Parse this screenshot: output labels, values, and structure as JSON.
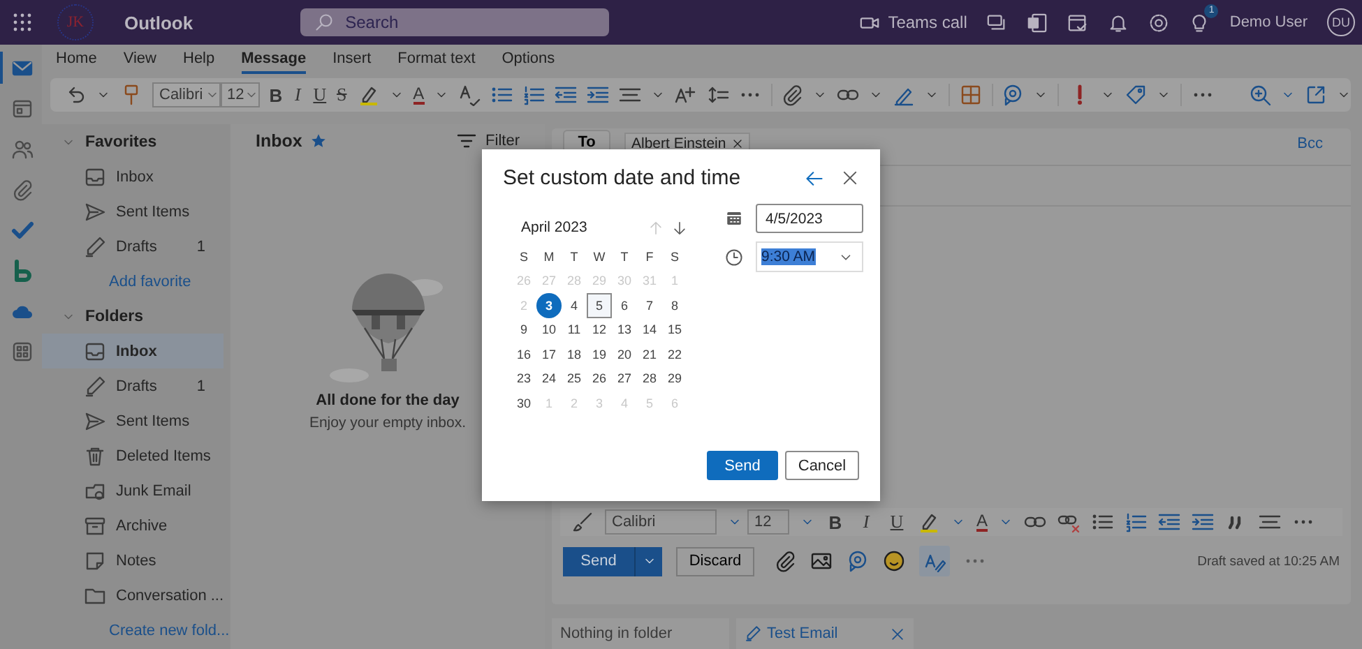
{
  "topbar": {
    "logo_text": "JK",
    "app_name": "Outlook",
    "search": {
      "placeholder": "Search"
    },
    "teams_call": "Teams call",
    "tips_badge": "1",
    "user_name": "Demo User",
    "avatar_initials": "DU"
  },
  "rail": [
    {
      "kind": "mail",
      "selected": true
    },
    {
      "kind": "calendar",
      "selected": false
    },
    {
      "kind": "people",
      "selected": false
    },
    {
      "kind": "files",
      "selected": false
    },
    {
      "kind": "todo",
      "selected": false
    },
    {
      "kind": "bookings",
      "selected": false
    },
    {
      "kind": "onedrive",
      "selected": false
    },
    {
      "kind": "apps",
      "selected": false
    }
  ],
  "ribbon": {
    "tabs": [
      {
        "label": "Home",
        "selected": false
      },
      {
        "label": "View",
        "selected": false
      },
      {
        "label": "Help",
        "selected": false
      },
      {
        "label": "Message",
        "selected": true
      },
      {
        "label": "Insert",
        "selected": false
      },
      {
        "label": "Format text",
        "selected": false
      },
      {
        "label": "Options",
        "selected": false
      }
    ],
    "font": "Calibri",
    "size": "12",
    "style_buttons": [
      {
        "kind": "bold",
        "label": "B"
      },
      {
        "kind": "italic",
        "label": "I"
      },
      {
        "kind": "underline",
        "label": "U"
      },
      {
        "kind": "strike",
        "label": "S"
      }
    ],
    "font_color": "A"
  },
  "folders": {
    "sections": [
      {
        "label": "Favorites",
        "items": [
          {
            "kind": "inbox",
            "label": "Inbox",
            "selected": false
          },
          {
            "kind": "sent",
            "label": "Sent Items",
            "selected": false
          },
          {
            "kind": "drafts",
            "label": "Drafts",
            "count": "1",
            "selected": false
          }
        ],
        "link": "Add favorite"
      },
      {
        "label": "Folders",
        "items": [
          {
            "kind": "inbox",
            "label": "Inbox",
            "selected": true
          },
          {
            "kind": "drafts",
            "label": "Drafts",
            "count": "1",
            "selected": false
          },
          {
            "kind": "sent",
            "label": "Sent Items",
            "selected": false
          },
          {
            "kind": "deleted",
            "label": "Deleted Items",
            "selected": false
          },
          {
            "kind": "junk",
            "label": "Junk Email",
            "selected": false
          },
          {
            "kind": "archive",
            "label": "Archive",
            "selected": false
          },
          {
            "kind": "notes",
            "label": "Notes",
            "selected": false
          },
          {
            "kind": "folder",
            "label": "Conversation ...",
            "selected": false
          }
        ],
        "link": "Create new fold..."
      }
    ]
  },
  "message_list": {
    "title": "Inbox",
    "filter": "Filter",
    "empty_title": "All done for the day",
    "empty_subtitle": "Enjoy your empty inbox."
  },
  "compose": {
    "to_label": "To",
    "recipients": [
      "Albert Einstein"
    ],
    "bcc": "Bcc",
    "font": "Calibri",
    "size": "12",
    "style_buttons": [
      {
        "kind": "bold",
        "label": "B"
      },
      {
        "kind": "italic",
        "label": "I"
      },
      {
        "kind": "underline",
        "label": "U"
      }
    ],
    "font_color": "A",
    "send": "Send",
    "discard": "Discard",
    "draft_status": "Draft saved at 10:25 AM"
  },
  "bottom_tabs": [
    {
      "label": "Nothing in folder",
      "selected": false
    },
    {
      "label": "Test Email",
      "selected": true
    }
  ],
  "dialog": {
    "title": "Set custom date and time",
    "month": "April 2023",
    "weekdays": [
      "S",
      "M",
      "T",
      "W",
      "T",
      "F",
      "S"
    ],
    "days": [
      {
        "day": "26",
        "kind": "outside",
        "selected": false
      },
      {
        "day": "27",
        "kind": "outside",
        "selected": false
      },
      {
        "day": "28",
        "kind": "outside",
        "selected": false
      },
      {
        "day": "29",
        "kind": "outside",
        "selected": false
      },
      {
        "day": "30",
        "kind": "outside",
        "selected": false
      },
      {
        "day": "31",
        "kind": "outside",
        "selected": false
      },
      {
        "day": "1",
        "kind": "outside",
        "selected": false
      },
      {
        "day": "2",
        "kind": "outside",
        "selected": false
      },
      {
        "day": "3",
        "kind": "today",
        "selected": false
      },
      {
        "day": "4",
        "kind": "current",
        "selected": false
      },
      {
        "day": "5",
        "kind": "current",
        "selected": true
      },
      {
        "day": "6",
        "kind": "current",
        "selected": false
      },
      {
        "day": "7",
        "kind": "current",
        "selected": false
      },
      {
        "day": "8",
        "kind": "current",
        "selected": false
      },
      {
        "day": "9",
        "kind": "current",
        "selected": false
      },
      {
        "day": "10",
        "kind": "current",
        "selected": false
      },
      {
        "day": "11",
        "kind": "current",
        "selected": false
      },
      {
        "day": "12",
        "kind": "current",
        "selected": false
      },
      {
        "day": "13",
        "kind": "current",
        "selected": false
      },
      {
        "day": "14",
        "kind": "current",
        "selected": false
      },
      {
        "day": "15",
        "kind": "current",
        "selected": false
      },
      {
        "day": "16",
        "kind": "current",
        "selected": false
      },
      {
        "day": "17",
        "kind": "current",
        "selected": false
      },
      {
        "day": "18",
        "kind": "current",
        "selected": false
      },
      {
        "day": "19",
        "kind": "current",
        "selected": false
      },
      {
        "day": "20",
        "kind": "current",
        "selected": false
      },
      {
        "day": "21",
        "kind": "current",
        "selected": false
      },
      {
        "day": "22",
        "kind": "current",
        "selected": false
      },
      {
        "day": "23",
        "kind": "current",
        "selected": false
      },
      {
        "day": "24",
        "kind": "current",
        "selected": false
      },
      {
        "day": "25",
        "kind": "current",
        "selected": false
      },
      {
        "day": "26",
        "kind": "current",
        "selected": false
      },
      {
        "day": "27",
        "kind": "current",
        "selected": false
      },
      {
        "day": "28",
        "kind": "current",
        "selected": false
      },
      {
        "day": "29",
        "kind": "current",
        "selected": false
      },
      {
        "day": "30",
        "kind": "current",
        "selected": false
      },
      {
        "day": "1",
        "kind": "outside",
        "selected": false
      },
      {
        "day": "2",
        "kind": "outside",
        "selected": false
      },
      {
        "day": "3",
        "kind": "outside",
        "selected": false
      },
      {
        "day": "4",
        "kind": "outside",
        "selected": false
      },
      {
        "day": "5",
        "kind": "outside",
        "selected": false
      },
      {
        "day": "6",
        "kind": "outside",
        "selected": false
      }
    ],
    "date": "4/5/2023",
    "time": "9:30 AM",
    "time_selected": true,
    "send": "Send",
    "cancel": "Cancel"
  }
}
